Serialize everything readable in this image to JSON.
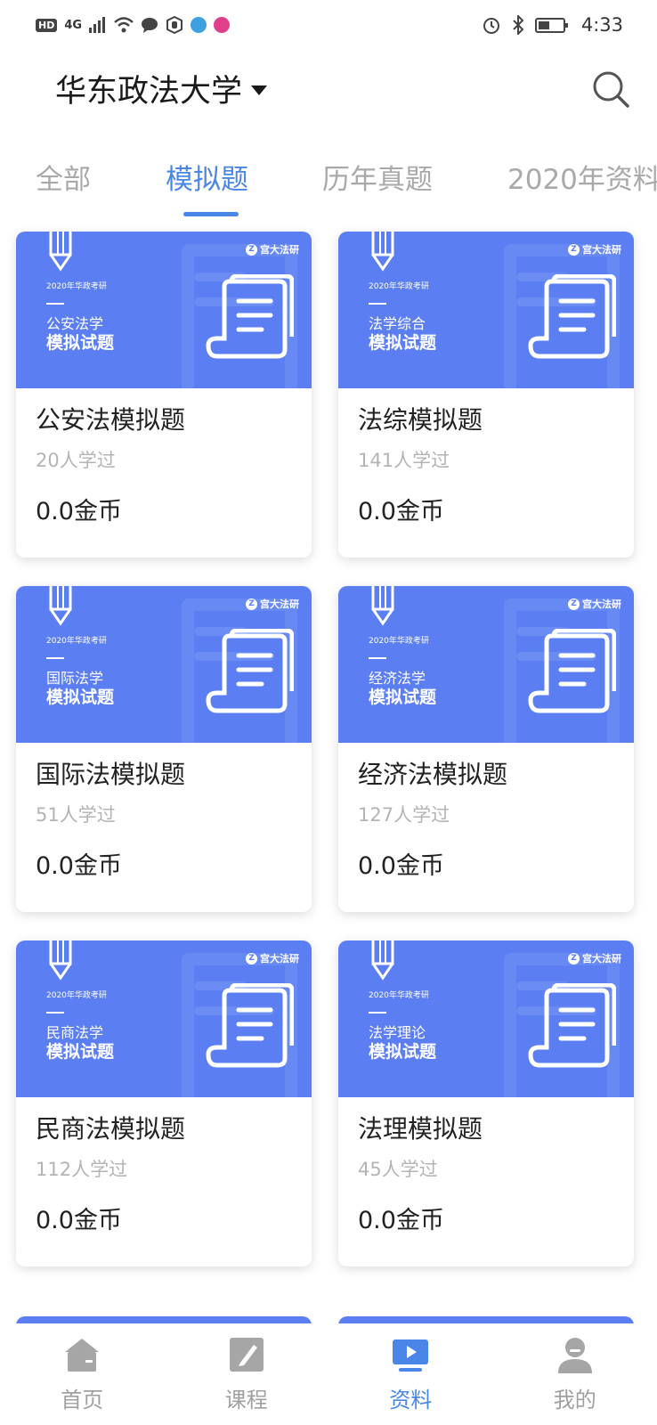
{
  "status_bar": {
    "hd": "HD",
    "network": "4G",
    "time": "4:33"
  },
  "header": {
    "school": "华东政法大学"
  },
  "tabs": [
    {
      "label": "全部",
      "active": false
    },
    {
      "label": "模拟题",
      "active": true
    },
    {
      "label": "历年真题",
      "active": false
    },
    {
      "label": "2020年资料",
      "active": false
    }
  ],
  "cards": [
    {
      "cover_year": "2020年华政考研",
      "cover_subject": "公安法学",
      "cover_title": "模拟试题",
      "brand": "宫大法研",
      "title": "公安法模拟题",
      "learners": "20人学过",
      "price": "0.0金币"
    },
    {
      "cover_year": "2020年华政考研",
      "cover_subject": "法学综合",
      "cover_title": "模拟试题",
      "brand": "宫大法研",
      "title": "法综模拟题",
      "learners": "141人学过",
      "price": "0.0金币"
    },
    {
      "cover_year": "2020年华政考研",
      "cover_subject": "国际法学",
      "cover_title": "模拟试题",
      "brand": "宫大法研",
      "title": "国际法模拟题",
      "learners": "51人学过",
      "price": "0.0金币"
    },
    {
      "cover_year": "2020年华政考研",
      "cover_subject": "经济法学",
      "cover_title": "模拟试题",
      "brand": "宫大法研",
      "title": "经济法模拟题",
      "learners": "127人学过",
      "price": "0.0金币"
    },
    {
      "cover_year": "2020年华政考研",
      "cover_subject": "民商法学",
      "cover_title": "模拟试题",
      "brand": "宫大法研",
      "title": "民商法模拟题",
      "learners": "112人学过",
      "price": "0.0金币"
    },
    {
      "cover_year": "2020年华政考研",
      "cover_subject": "法学理论",
      "cover_title": "模拟试题",
      "brand": "宫大法研",
      "title": "法理模拟题",
      "learners": "45人学过",
      "price": "0.0金币"
    }
  ],
  "bottom_nav": [
    {
      "label": "首页",
      "icon": "home-icon",
      "active": false
    },
    {
      "label": "课程",
      "icon": "course-icon",
      "active": false
    },
    {
      "label": "资料",
      "icon": "materials-icon",
      "active": true
    },
    {
      "label": "我的",
      "icon": "profile-icon",
      "active": false
    }
  ],
  "colors": {
    "accent": "#4a86e8",
    "cover": "#5b7ff2",
    "inactive_tab": "#a9a9a9",
    "muted_text": "#b4b4b4"
  }
}
